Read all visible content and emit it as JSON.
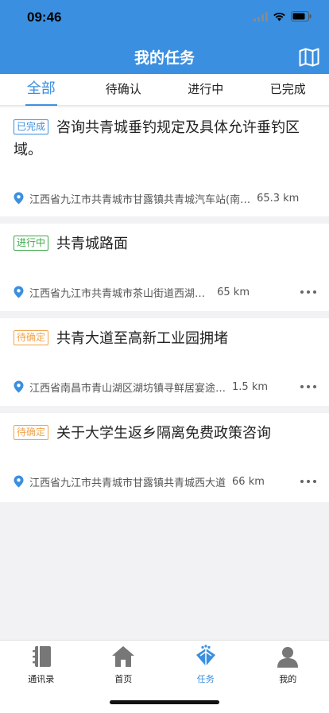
{
  "status_bar": {
    "time": "09:46"
  },
  "header": {
    "title": "我的任务",
    "map_icon": "map-icon"
  },
  "tabs": [
    {
      "label": "全部",
      "active": true
    },
    {
      "label": "待确认",
      "active": false
    },
    {
      "label": "进行中",
      "active": false
    },
    {
      "label": "已完成",
      "active": false
    }
  ],
  "tasks": [
    {
      "status": "已完成",
      "title": "咨询共青城垂钓规定及具体允许垂钓区域。",
      "address": "江西省九江市共青城市甘露镇共青城汽车站(南…",
      "distance": "65.3 km",
      "has_more": false
    },
    {
      "status": "进行中",
      "title": "共青城路面",
      "address": "江西省九江市共青城市茶山街道西湖公园",
      "distance": "65 km",
      "has_more": true
    },
    {
      "status": "待确定",
      "title": "共青大道至高新工业园拥堵",
      "address": "江西省南昌市青山湖区湖坊镇寻鲜居宴途…",
      "distance": "1.5 km",
      "has_more": true
    },
    {
      "status": "待确定",
      "title": "关于大学生返乡隔离免费政策咨询",
      "address": "江西省九江市共青城市甘露镇共青城西大道",
      "distance": "66 km",
      "has_more": true
    }
  ],
  "tabbar": [
    {
      "label": "通讯录",
      "icon": "address-book-icon",
      "active": false
    },
    {
      "label": "首页",
      "icon": "home-icon",
      "active": false
    },
    {
      "label": "任务",
      "icon": "task-icon",
      "active": true
    },
    {
      "label": "我的",
      "icon": "profile-icon",
      "active": false
    }
  ],
  "colors": {
    "accent": "#3b8fe0",
    "done": "#3b8fe0",
    "progress": "#3ea84b",
    "pending": "#f0a34a"
  }
}
